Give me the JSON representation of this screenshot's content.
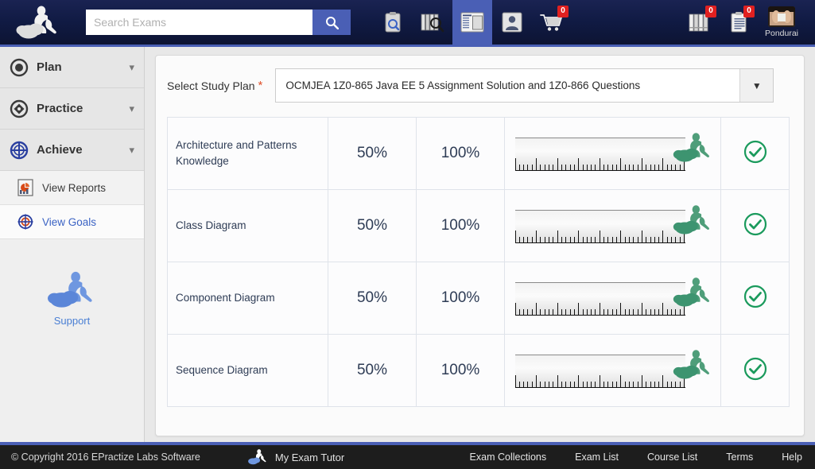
{
  "header": {
    "logo_icon": "person-on-cloud-logo",
    "search": {
      "placeholder": "Search Exams",
      "value": "",
      "button_icon": "search-icon"
    },
    "nav": [
      {
        "name": "clipboard-search-icon",
        "label": "Exam Search",
        "active": false,
        "badge": ""
      },
      {
        "name": "books-search-icon",
        "label": "Course Search",
        "active": false,
        "badge": ""
      },
      {
        "name": "window-layout-icon",
        "label": "Study Plan",
        "active": true,
        "badge": ""
      },
      {
        "name": "user-icon",
        "label": "Profile",
        "active": false,
        "badge": ""
      },
      {
        "name": "cart-icon",
        "label": "Cart",
        "active": false,
        "badge": "0"
      }
    ],
    "right": [
      {
        "name": "books-icon",
        "label": "My Courses",
        "badge": "0"
      },
      {
        "name": "document-icon",
        "label": "My Exams",
        "badge": "0"
      }
    ],
    "user": {
      "name": "Pondurai",
      "avatar_icon": "user-avatar"
    }
  },
  "sidebar": {
    "groups": [
      {
        "label": "Plan",
        "icon": "circle-dot-icon",
        "expanded": false,
        "chevron": "chevron-down-icon"
      },
      {
        "label": "Practice",
        "icon": "target-diamond-icon",
        "expanded": false,
        "chevron": "chevron-down-icon"
      },
      {
        "label": "Achieve",
        "icon": "target-cross-icon",
        "expanded": true,
        "chevron": "chevron-down-icon"
      }
    ],
    "items": [
      {
        "label": "View Reports",
        "icon": "report-chart-icon",
        "selected": false
      },
      {
        "label": "View Goals",
        "icon": "goal-target-icon",
        "selected": true
      }
    ],
    "support": {
      "label": "Support",
      "icon": "person-on-cloud-support-icon"
    }
  },
  "main": {
    "plan_label": "Select Study Plan",
    "required_mark": "*",
    "selected_plan": "OCMJEA 1Z0-865 Java EE 5 Assignment Solution and 1Z0-866 Questions",
    "dropdown_arrow": "▼",
    "rows": [
      {
        "name": "Architecture and Patterns Knowledge",
        "current": "50%",
        "target": "100%",
        "progress": 50,
        "status_icon": "check-circle-icon"
      },
      {
        "name": "Class Diagram",
        "current": "50%",
        "target": "100%",
        "progress": 50,
        "status_icon": "check-circle-icon"
      },
      {
        "name": "Component Diagram",
        "current": "50%",
        "target": "100%",
        "progress": 50,
        "status_icon": "check-circle-icon"
      },
      {
        "name": "Sequence Diagram",
        "current": "50%",
        "target": "100%",
        "progress": 50,
        "status_icon": "check-circle-icon"
      }
    ]
  },
  "footer": {
    "copyright": "© Copyright 2016 EPractize Labs Software",
    "brand": "My Exam Tutor",
    "brand_icon": "person-on-cloud-logo-small",
    "links": [
      "Exam Collections",
      "Exam List",
      "Course List",
      "Terms",
      "Help"
    ]
  },
  "colors": {
    "header_bg": "#101a43",
    "accent_blue": "#4a5fb5",
    "badge_red": "#e02020",
    "link_blue": "#3b63c4",
    "status_green": "#1a9a5c",
    "required_red": "#e0502a"
  }
}
